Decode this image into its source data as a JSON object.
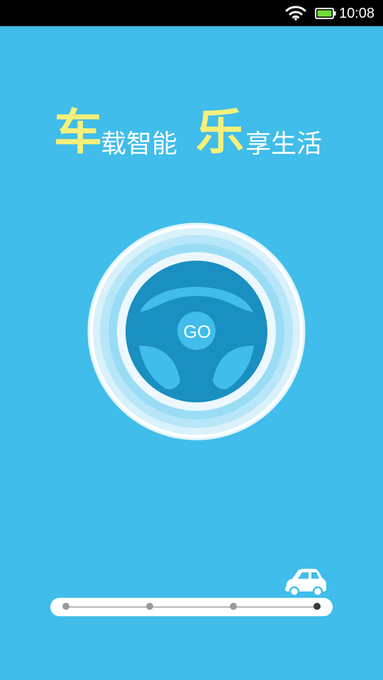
{
  "status_bar": {
    "time": "10:08"
  },
  "slogan": {
    "char_1": "车",
    "part_1": "载智能",
    "char_2": "乐",
    "part_2": "享生活"
  },
  "start_button": {
    "label": "GO"
  },
  "progress": {
    "steps": 4,
    "current_step": 4
  },
  "colors": {
    "background": "#40bdea",
    "highlight": "#f6f07a",
    "wheel": "#1a8fc1"
  }
}
